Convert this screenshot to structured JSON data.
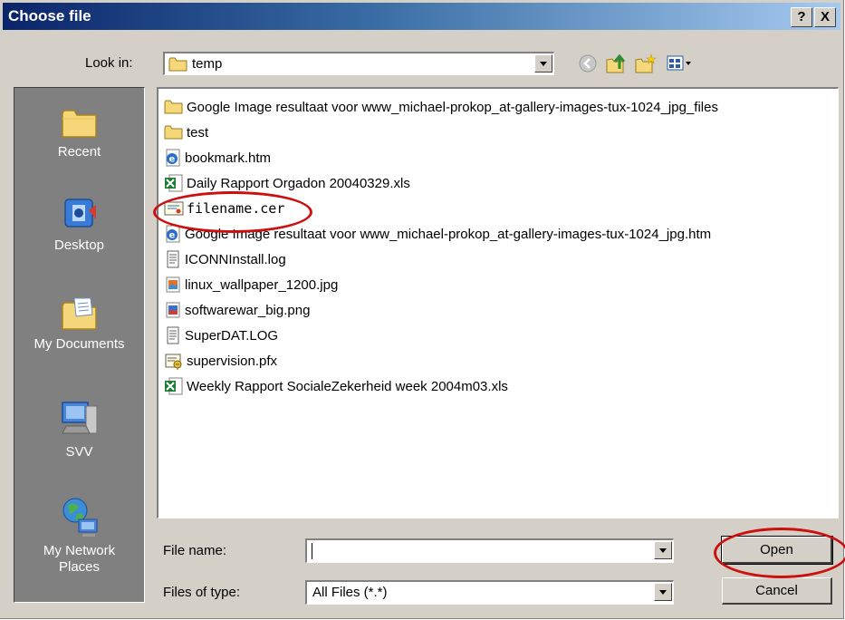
{
  "dialog": {
    "title": "Choose file",
    "help_label": "?",
    "close_label": "X"
  },
  "lookin": {
    "label": "Look in:",
    "value": "temp"
  },
  "places": [
    {
      "label": "Recent"
    },
    {
      "label": "Desktop"
    },
    {
      "label": "My Documents"
    },
    {
      "label": "SVV"
    },
    {
      "label": "My Network Places"
    }
  ],
  "files": [
    {
      "name": "Google Image resultaat voor www_michael-prokop_at-gallery-images-tux-1024_jpg_files",
      "icon": "folder-icon"
    },
    {
      "name": "test",
      "icon": "folder-icon"
    },
    {
      "name": "bookmark.htm",
      "icon": "html-file-icon"
    },
    {
      "name": "Daily Rapport Orgadon 20040329.xls",
      "icon": "excel-file-icon"
    },
    {
      "name": "filename.cer",
      "icon": "certificate-file-icon"
    },
    {
      "name": "Google Image resultaat voor www_michael-prokop_at-gallery-images-tux-1024_jpg.htm",
      "icon": "html-file-icon"
    },
    {
      "name": "ICONNInstall.log",
      "icon": "text-file-icon"
    },
    {
      "name": "linux_wallpaper_1200.jpg",
      "icon": "image-file-icon"
    },
    {
      "name": "softwarewar_big.png",
      "icon": "image-file-icon"
    },
    {
      "name": "SuperDAT.LOG",
      "icon": "text-file-icon"
    },
    {
      "name": "supervision.pfx",
      "icon": "pfx-file-icon"
    },
    {
      "name": "Weekly Rapport SocialeZekerheid week 2004m03.xls",
      "icon": "excel-file-icon"
    }
  ],
  "filename": {
    "label": "File name:",
    "value": ""
  },
  "filetype": {
    "label": "Files of type:",
    "value": "All Files (*.*)"
  },
  "buttons": {
    "open": "Open",
    "cancel": "Cancel"
  },
  "colors": {
    "title_bar": "#0a246a",
    "face": "#d4d0c8",
    "places_bar": "#808080",
    "annotation": "#cc1010"
  }
}
